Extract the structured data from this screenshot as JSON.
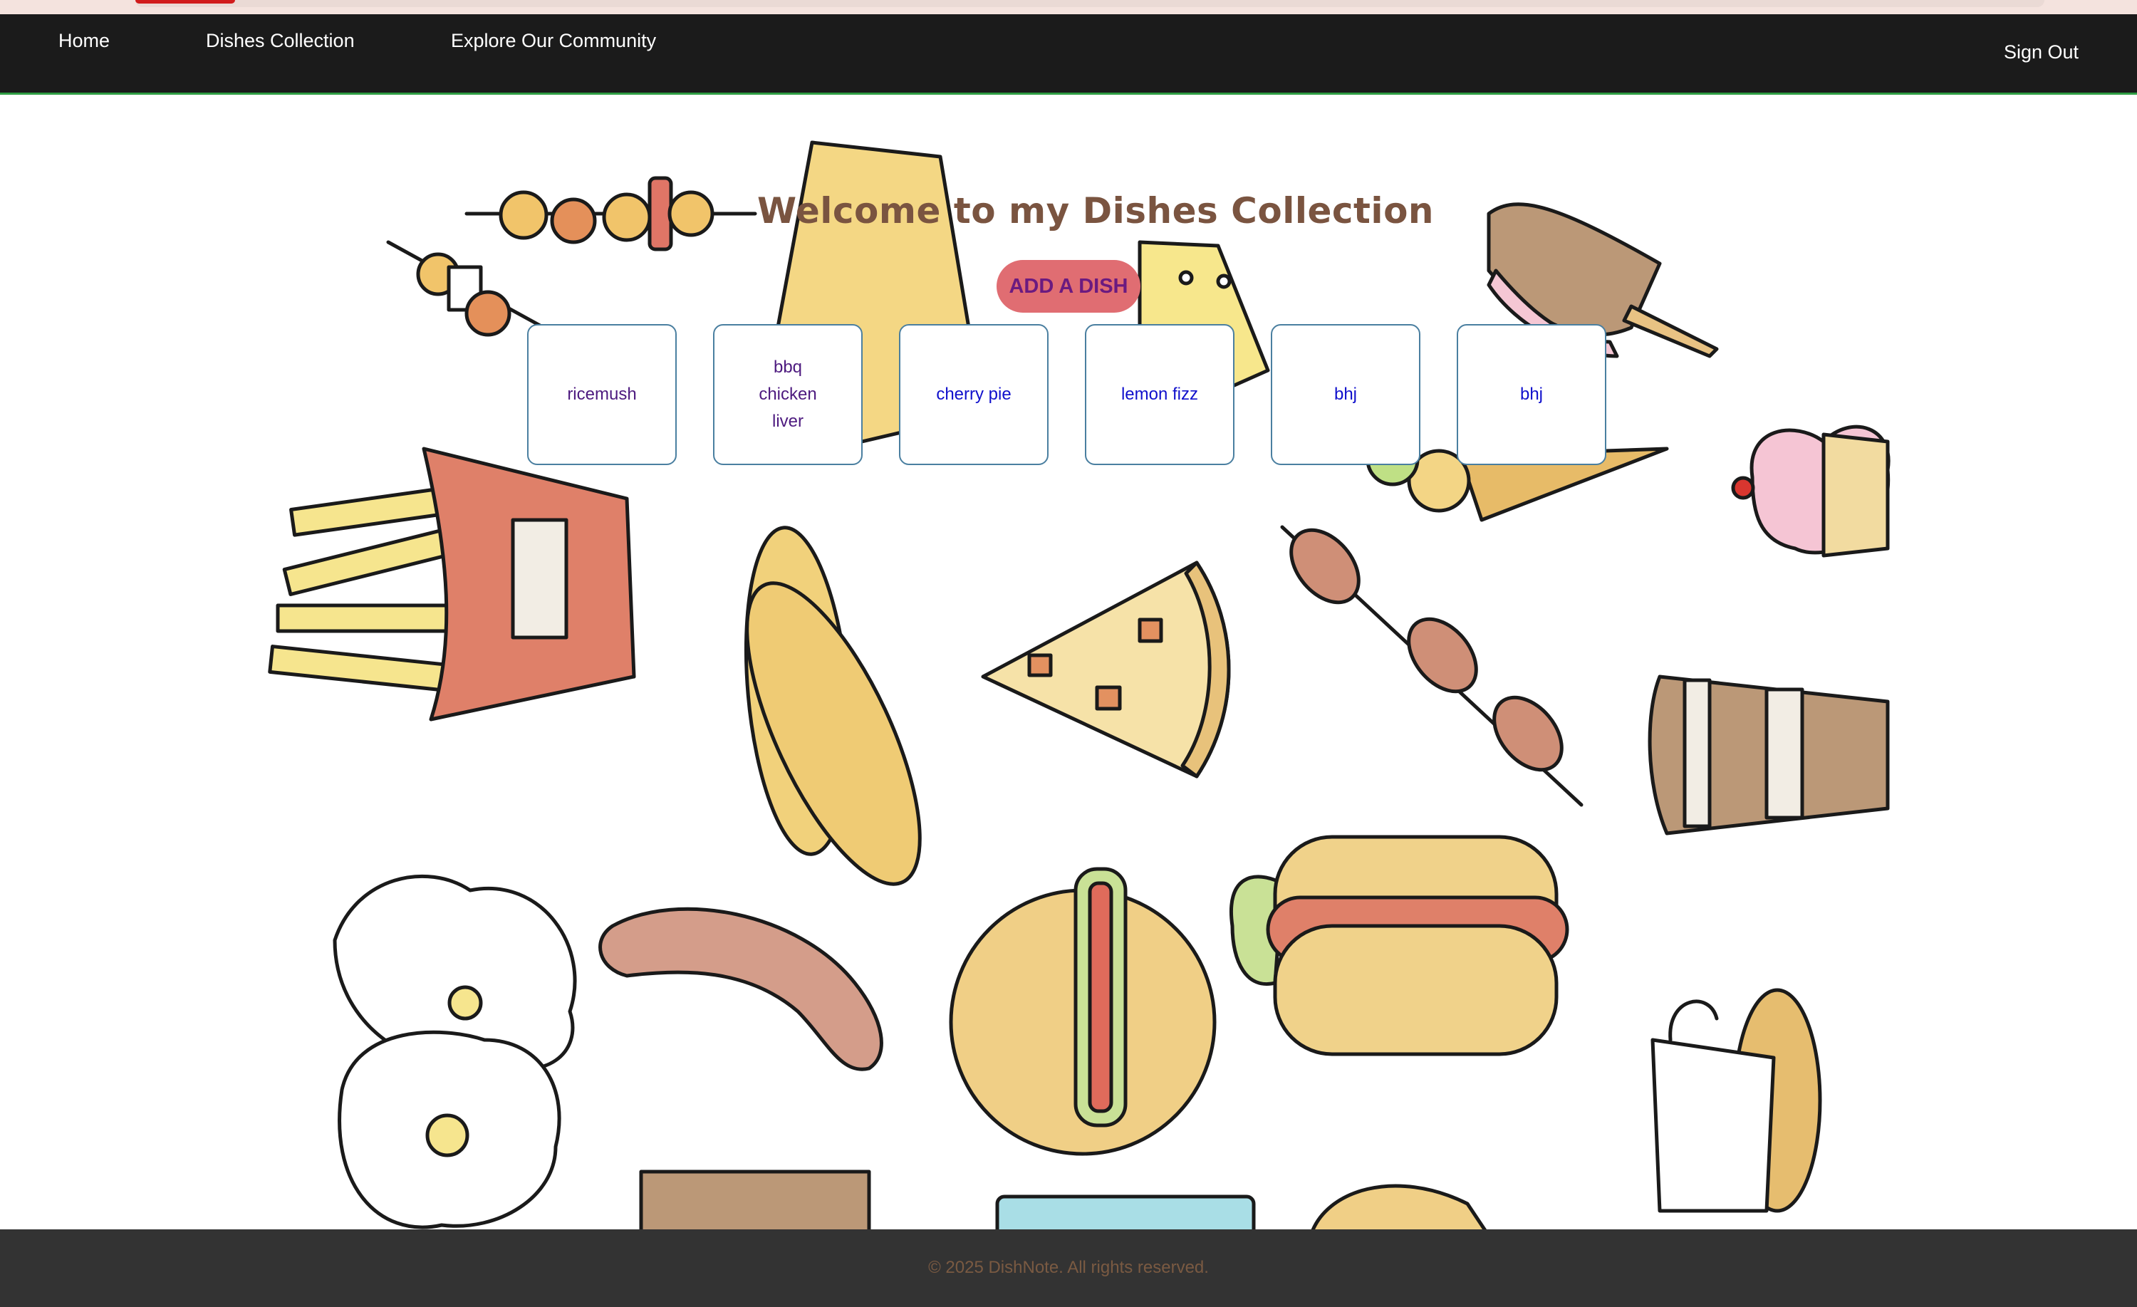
{
  "nav": {
    "links": [
      {
        "label": "Home"
      },
      {
        "label": "Dishes Collection"
      },
      {
        "label": "Explore Our Community"
      }
    ],
    "sign_out": "Sign Out"
  },
  "main": {
    "heading": "Welcome to my Dishes Collection",
    "add_button": "ADD A DISH",
    "dishes": [
      {
        "name": "ricemush"
      },
      {
        "name": "bbq chicken liver"
      },
      {
        "name": "cherry pie"
      },
      {
        "name": "lemon fizz"
      },
      {
        "name": "bhj"
      },
      {
        "name": "bhj"
      }
    ]
  },
  "footer": {
    "copyright": "© 2025 DishNote. All rights reserved."
  },
  "colors": {
    "navbar": "#1b1b1b",
    "nav_accent": "#2f9e44",
    "heading": "#7a5440",
    "button_bg": "#e06d72",
    "button_text": "#6b1a80",
    "card_border": "#4a7fa0",
    "footer_bg": "#333333",
    "footer_text": "#7a5a42"
  }
}
